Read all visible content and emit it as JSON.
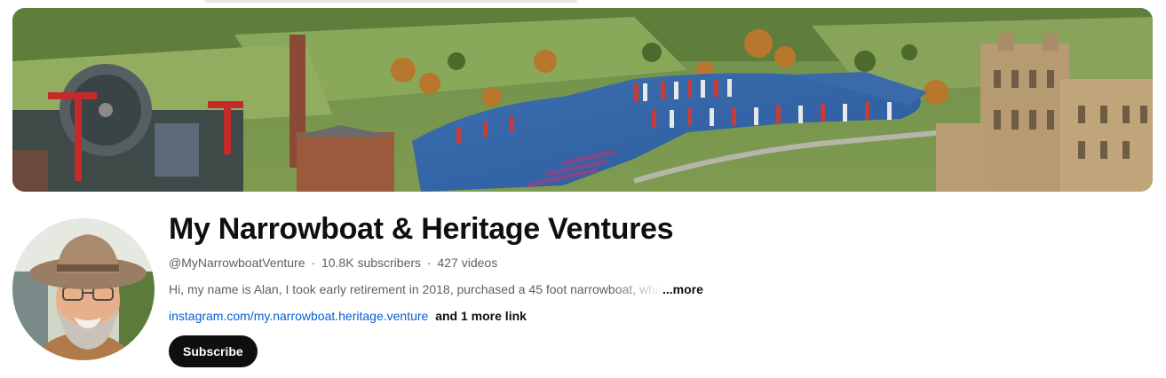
{
  "channel": {
    "title": "My Narrowboat & Heritage Ventures",
    "handle": "@MyNarrowboatVenture",
    "subscribers": "10.8K subscribers",
    "videos": "427 videos",
    "separator": "·",
    "description": "Hi, my name is Alan, I took early retirement in 2018, purchased a 45 foot narrowboat, which",
    "more_label": "...more",
    "link_text": "instagram.com/my.narrowboat.heritage.venture",
    "more_links_label": "and 1 more link",
    "subscribe_label": "Subscribe"
  },
  "colors": {
    "link": "#065fd4",
    "subscribe_bg": "#0f0f0f",
    "meta_text": "#606060"
  }
}
